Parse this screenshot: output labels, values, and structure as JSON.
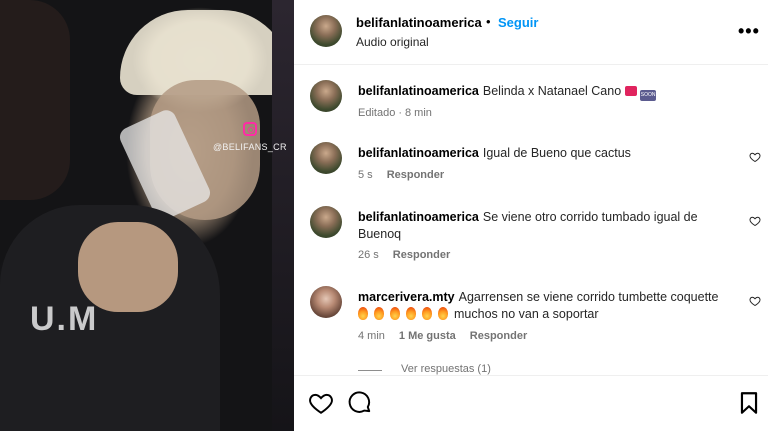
{
  "media": {
    "watermark_text": "@BELIFANS_CR",
    "shirt_print": "U.M"
  },
  "header": {
    "username": "belifanlatinoamerica",
    "separator": "•",
    "follow_label": "Seguir",
    "audio_label": "Audio original",
    "more_label": "•••"
  },
  "caption": {
    "username": "belifanlatinoamerica",
    "text": "Belinda x Natanael Cano",
    "edited": "Editado",
    "time": "8 min",
    "meta_sep": "·",
    "emoji_soon_label": "SOON"
  },
  "comments": [
    {
      "username": "belifanlatinoamerica",
      "text": "Igual de Bueno que cactus",
      "time": "5 s",
      "reply_label": "Responder"
    },
    {
      "username": "belifanlatinoamerica",
      "text": "Se viene otro corrido tumbado igual de Buenoq",
      "time": "26 s",
      "reply_label": "Responder"
    },
    {
      "username": "marcerivera.mty",
      "text_before": "Agarrensen se viene corrido tumbette coquette",
      "text_after": "muchos no van a soportar",
      "time": "4 min",
      "likes": "1 Me gusta",
      "reply_label": "Responder",
      "view_replies": "Ver respuestas (1)"
    }
  ],
  "icons": {
    "heart": "heart-icon",
    "comment": "comment-icon",
    "bookmark": "bookmark-icon"
  },
  "colors": {
    "follow_blue": "#0095f6",
    "meta_gray": "#737373",
    "instagram_pink": "#ff2aa6"
  }
}
